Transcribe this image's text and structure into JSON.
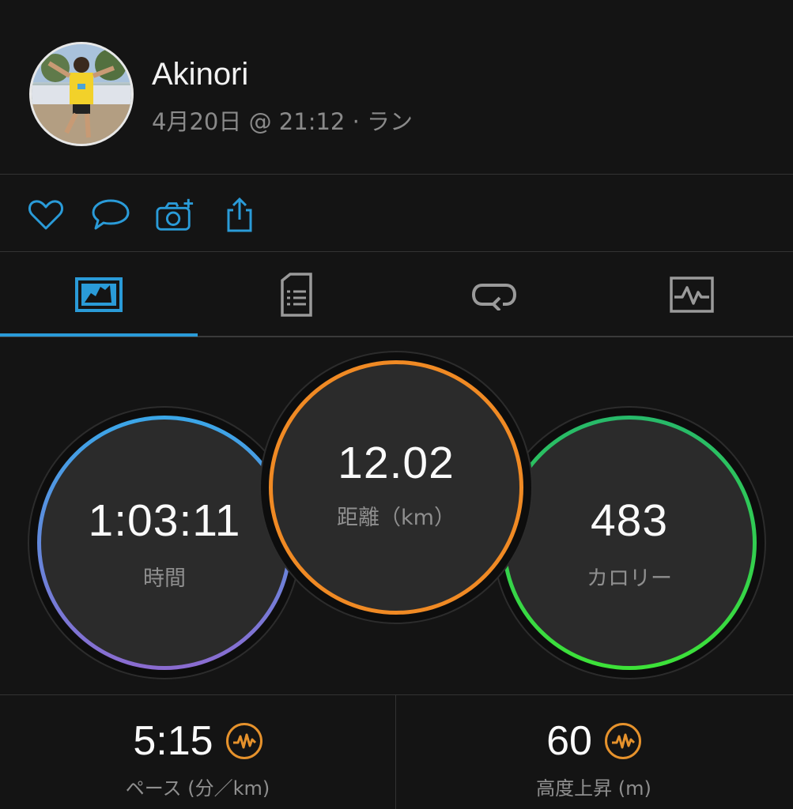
{
  "user": {
    "name": "Akinori",
    "date": "4月20日",
    "time": "@ 21:12",
    "activity": "· ラン"
  },
  "actions": {
    "like_icon": "heart-icon",
    "comment_icon": "comment-icon",
    "photo_icon": "add-photo-icon",
    "share_icon": "share-icon"
  },
  "tabs": [
    {
      "icon": "overview-icon",
      "active": true
    },
    {
      "icon": "details-icon",
      "active": false
    },
    {
      "icon": "laps-icon",
      "active": false
    },
    {
      "icon": "chart-icon",
      "active": false
    }
  ],
  "metrics": {
    "time": {
      "value": "1:03:11",
      "label": "時間"
    },
    "distance": {
      "value": "12.02",
      "label": "距離（km）"
    },
    "calories": {
      "value": "483",
      "label": "カロリー"
    }
  },
  "stats": {
    "pace": {
      "value": "5:15",
      "label": "ペース (分／km)"
    },
    "elevation": {
      "value": "60",
      "label": "高度上昇 (m)"
    }
  },
  "colors": {
    "accent": "#2a9bd8",
    "time_ring_top": "#3aa7e8",
    "time_ring_bottom": "#8b6bd0",
    "distance_ring": "#f08a24",
    "calories_ring": "#27d45a",
    "pace_icon": "#e6922c"
  }
}
